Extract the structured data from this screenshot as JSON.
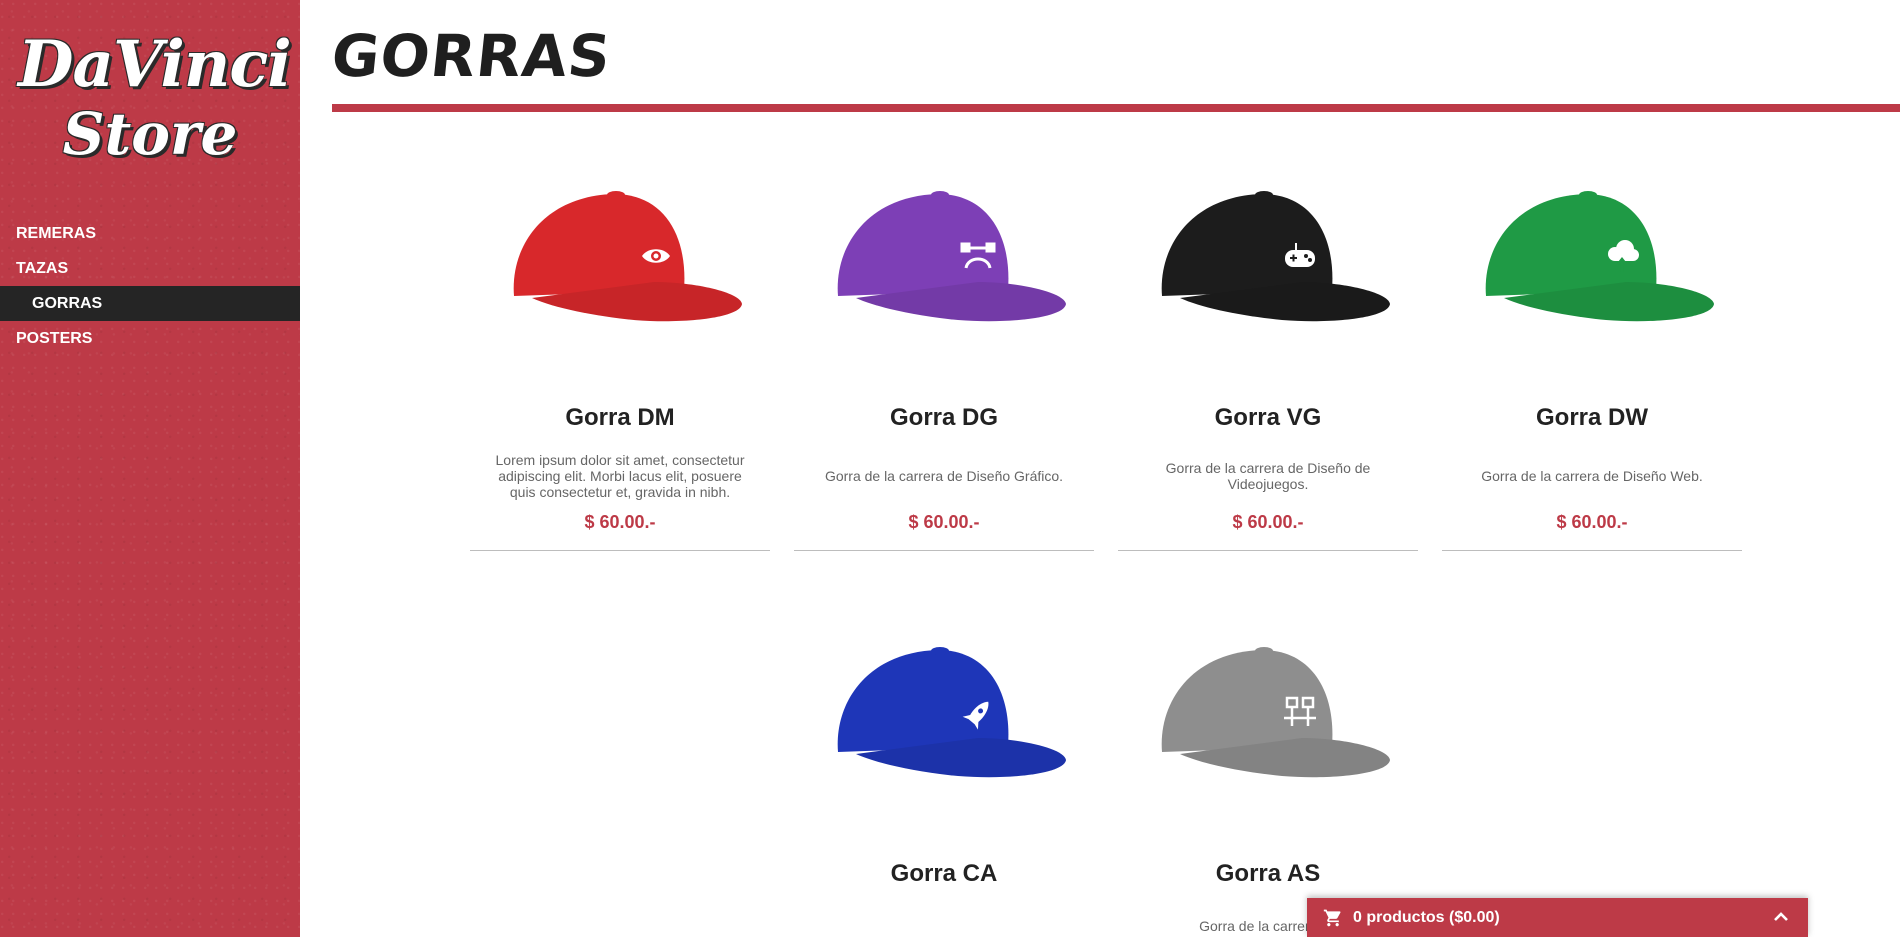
{
  "brand": {
    "line1": "DaVinci",
    "line2": "Store"
  },
  "nav": {
    "items": [
      {
        "label": "REMERAS",
        "active": false
      },
      {
        "label": "TAZAS",
        "active": false
      },
      {
        "label": "GORRAS",
        "active": true
      },
      {
        "label": "POSTERS",
        "active": false
      }
    ]
  },
  "page": {
    "title": "GORRAS"
  },
  "products": [
    {
      "name": "Gorra DM",
      "description": "Lorem ipsum dolor sit amet, consectetur adipiscing elit. Morbi lacus elit, posuere quis consectetur et, gravida in nibh.",
      "price": "$ 60.00.-",
      "color": "#d8282b",
      "icon": "eye-icon"
    },
    {
      "name": "Gorra DG",
      "description": "Gorra de la carrera de Diseño Gráfico.",
      "price": "$ 60.00.-",
      "color": "#7d3fb6",
      "icon": "pen-tool-icon"
    },
    {
      "name": "Gorra VG",
      "description": "Gorra de la carrera de Diseño de Videojuegos.",
      "price": "$ 60.00.-",
      "color": "#1c1c1c",
      "icon": "gamepad-icon"
    },
    {
      "name": "Gorra DW",
      "description": "Gorra de la carrera de Diseño Web.",
      "price": "$ 60.00.-",
      "color": "#1f9a45",
      "icon": "cloud-upload-icon"
    },
    {
      "name": "Gorra CA",
      "description": "",
      "price": "",
      "color": "#1e36b8",
      "icon": "rocket-icon"
    },
    {
      "name": "Gorra AS",
      "description": "Gorra de la carrera de",
      "price": "",
      "color": "#8e8e8e",
      "icon": "network-icon"
    }
  ],
  "cart": {
    "label": "0 productos ($0.00)",
    "icon": "cart-icon",
    "toggle_icon": "chevron-up-icon"
  },
  "colors": {
    "accent": "#bd3a47",
    "active_nav": "#252525"
  }
}
